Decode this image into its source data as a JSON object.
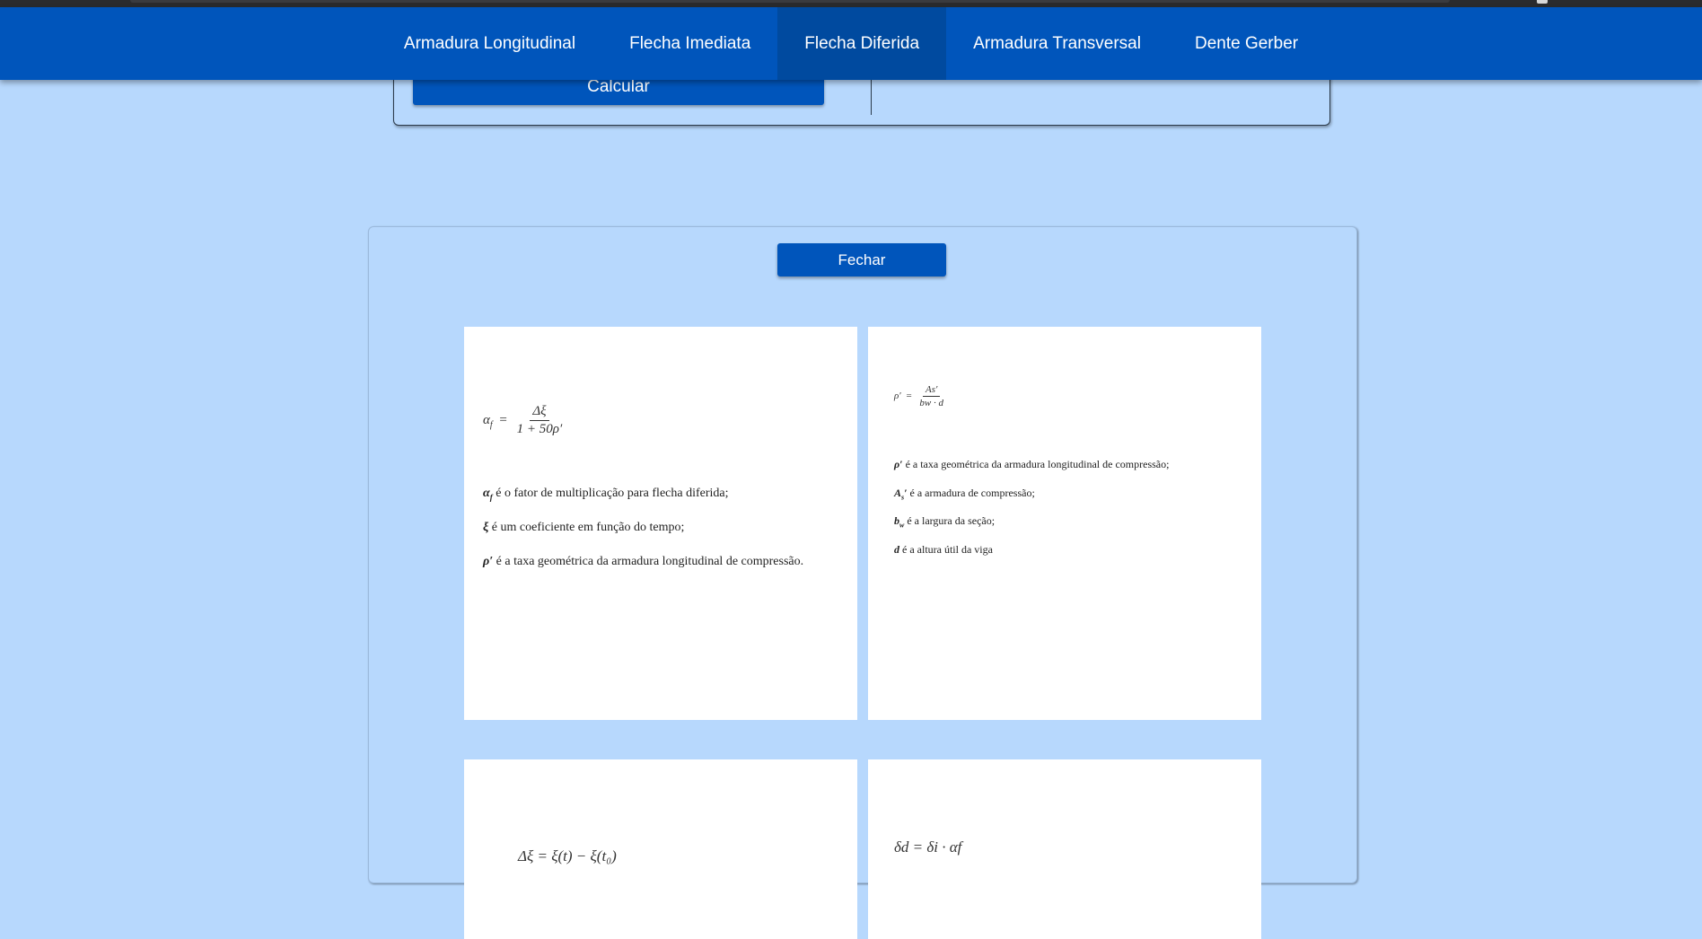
{
  "nav": {
    "items": [
      {
        "label": "Armadura Longitudinal"
      },
      {
        "label": "Flecha Imediata"
      },
      {
        "label": "Flecha Diferida",
        "active": true
      },
      {
        "label": "Armadura Transversal"
      },
      {
        "label": "Dente Gerber"
      }
    ]
  },
  "calc_panel": {
    "button_label": "Calcular"
  },
  "modal": {
    "close_label": "Fechar",
    "cards": [
      {
        "formula": {
          "lhs": "α",
          "lhs_sub": "f",
          "eq": "=",
          "num": "Δξ",
          "den": "1 + 50ρ′"
        },
        "definitions": [
          {
            "symbol": "α",
            "symbol_sub": "f",
            "text": " é o fator de multiplicação para flecha diferida;"
          },
          {
            "symbol": "ξ",
            "symbol_sub": "",
            "text": " é um coeficiente em função do tempo;"
          },
          {
            "symbol": "ρ′",
            "symbol_sub": "",
            "text": " é a taxa geométrica da armadura longitudinal de compressão."
          }
        ]
      },
      {
        "formula": {
          "lhs": "ρ′",
          "eq": "=",
          "num": "As′",
          "den": "bw · d"
        },
        "definitions": [
          {
            "symbol": "ρ′",
            "symbol_sub": "",
            "text": " é a taxa geométrica da armadura longitudinal de compressão;"
          },
          {
            "symbol": "A",
            "symbol_sub": "s",
            "symbol_post": "′",
            "text": " é a armadura de compressão;"
          },
          {
            "symbol": "b",
            "symbol_sub": "w",
            "text": " é a largura da seção;"
          },
          {
            "symbol": "d",
            "symbol_sub": "",
            "text": " é a altura útil da viga"
          }
        ]
      },
      {
        "formula_text": "Δξ = ξ(t) − ξ(t₀)"
      },
      {
        "formula_text": "δd = δi · αf"
      }
    ]
  }
}
